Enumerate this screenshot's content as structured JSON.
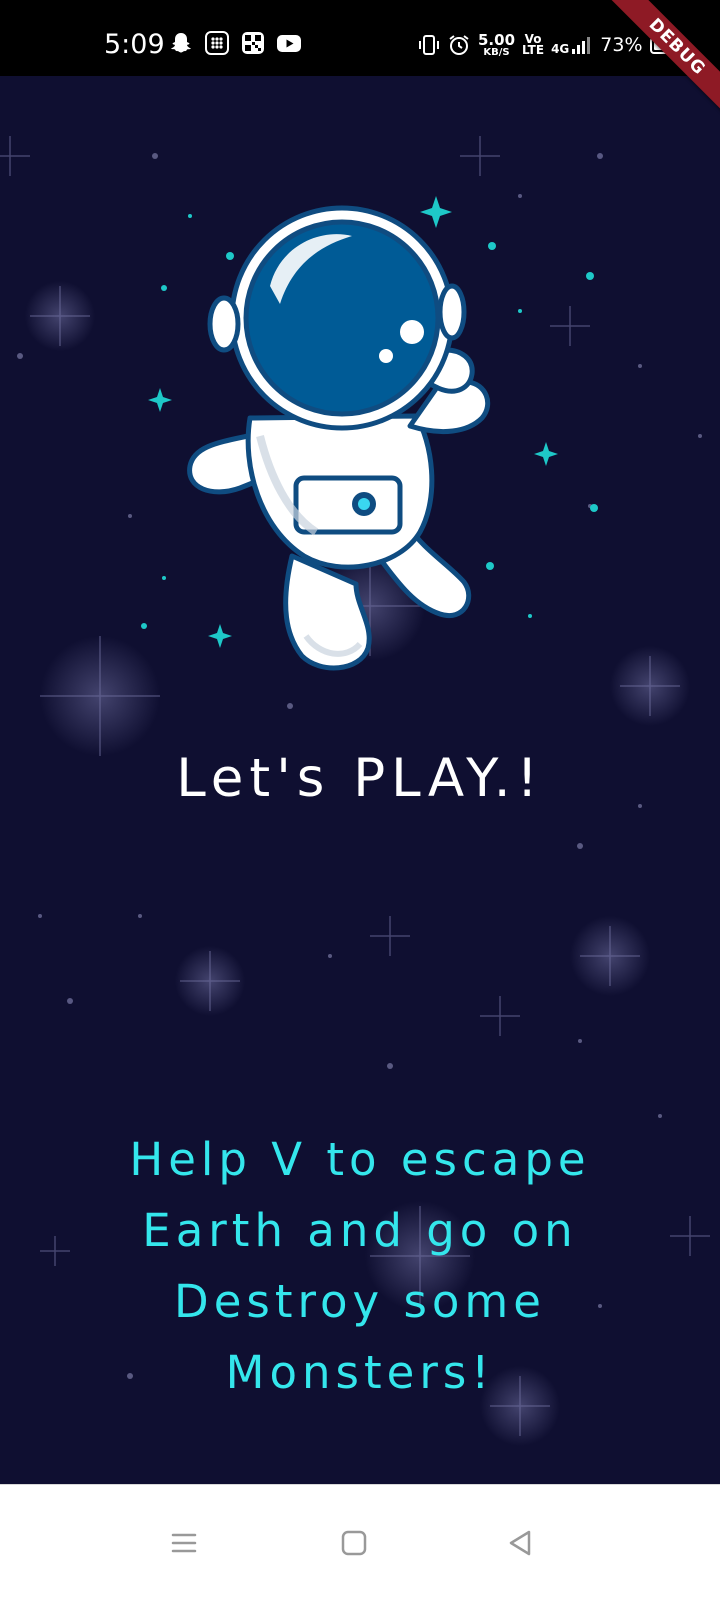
{
  "status_bar": {
    "time": "5:09",
    "net_speed_value": "5.00",
    "net_speed_unit": "KB/S",
    "volte_top": "Vo",
    "volte_bottom": "LTE",
    "network_type": "4G",
    "battery_percent": "73%",
    "battery_level": 0.73,
    "left_icons": [
      "snapchat-icon",
      "dialpad-app-icon",
      "qr-app-icon",
      "youtube-icon"
    ],
    "right_icons": [
      "vibrate-icon",
      "alarm-icon",
      "signal-icon",
      "battery-icon"
    ]
  },
  "debug_banner": "DEBUG",
  "content": {
    "headline": "Let's PLAY.!",
    "subtext": "Help V to escape Earth and go on Destroy some Monsters!"
  },
  "colors": {
    "background": "#0f0f31",
    "headline": "#ffffff",
    "subtext": "#34e6ec",
    "astronaut_helmet": "#005b96",
    "sparkle_accent": "#1ec8c8",
    "debug_banner": "#8e1a25"
  },
  "nav_bar": {
    "icons": [
      "menu-icon",
      "home-square-icon",
      "back-triangle-icon"
    ]
  }
}
